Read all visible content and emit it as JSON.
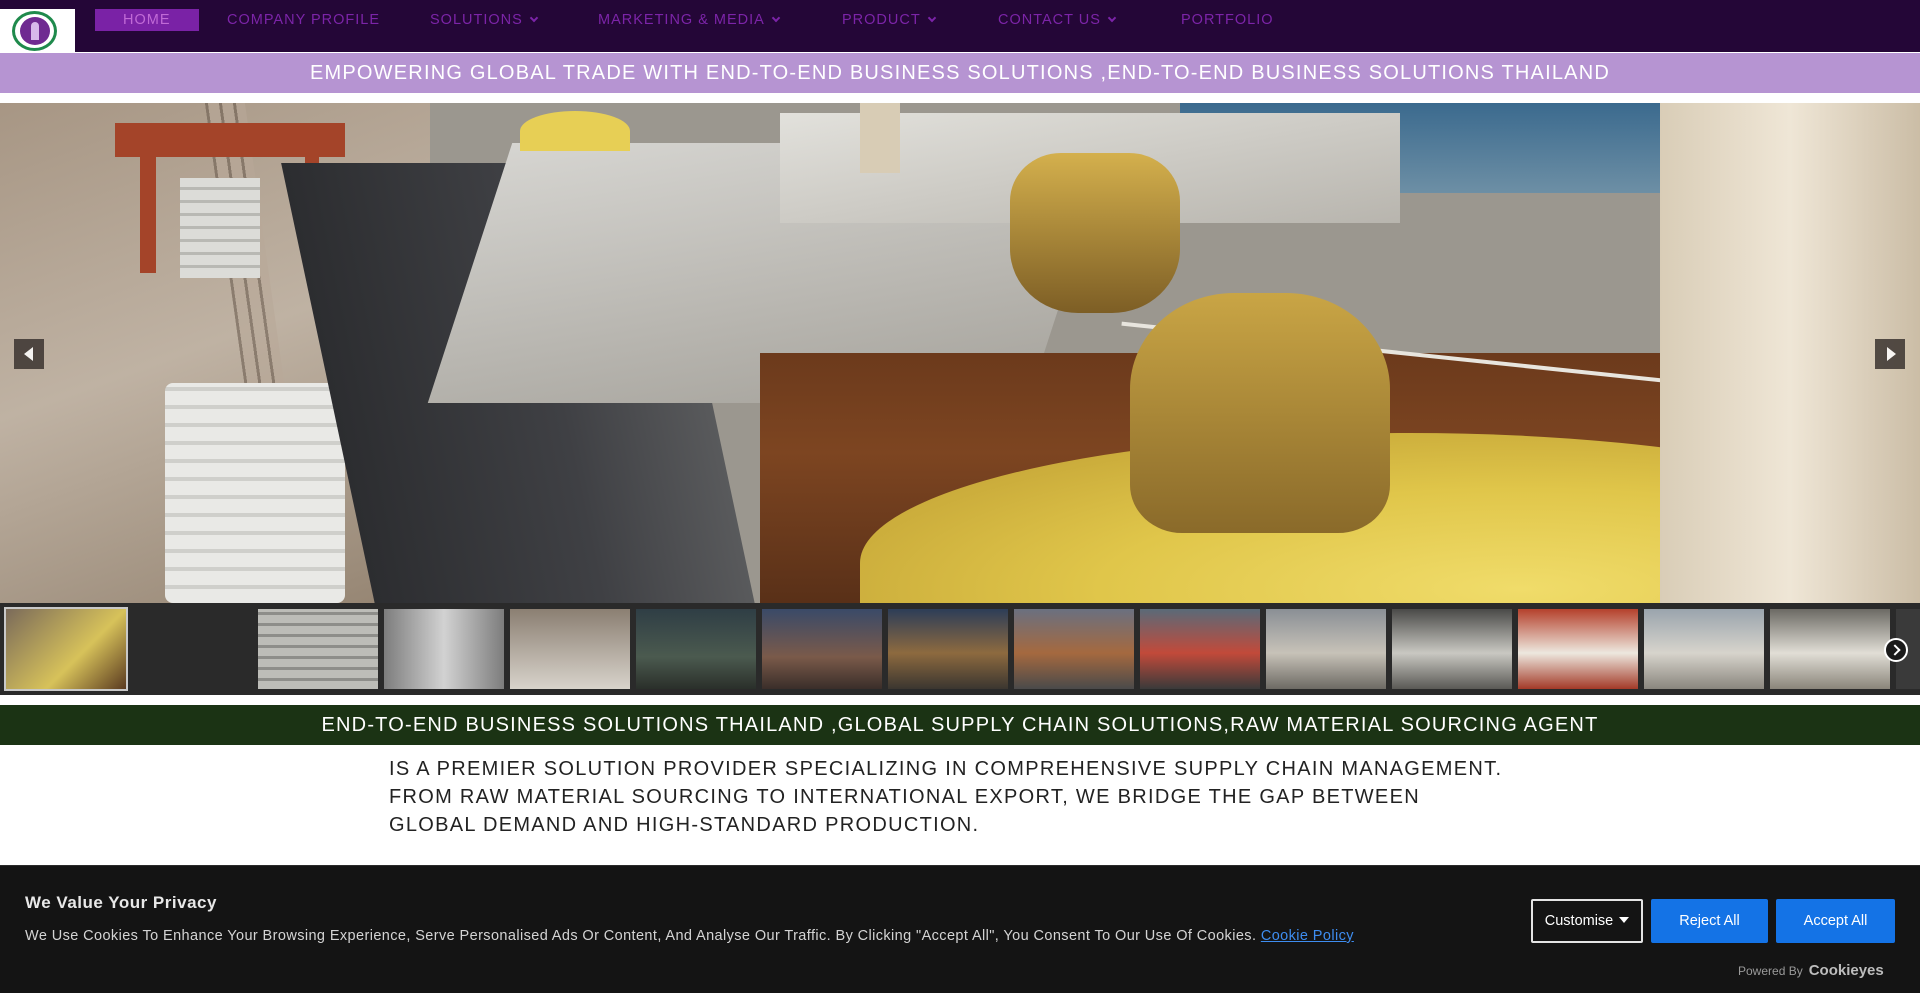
{
  "nav": {
    "items": [
      {
        "label": "HOME",
        "active": true
      },
      {
        "label": "COMPANY PROFILE"
      },
      {
        "label": "SOLUTIONS",
        "dropdown": true
      },
      {
        "label": "MARKETING & MEDIA",
        "dropdown": true
      },
      {
        "label": "PRODUCT",
        "dropdown": true
      },
      {
        "label": "CONTACT US",
        "dropdown": true
      },
      {
        "label": "PORTFOLIO"
      }
    ]
  },
  "banner": {
    "text": "EMPOWERING GLOBAL TRADE WITH END-TO-END BUSINESS SOLUTIONS ,END-TO-END BUSINESS SOLUTIONS THAILAND"
  },
  "thumbnails": {
    "count": 16,
    "selected_index": 0
  },
  "green_banner": {
    "text": "END-TO-END BUSINESS SOLUTIONS THAILAND ,GLOBAL SUPPLY CHAIN SOLUTIONS,RAW MATERIAL SOURCING AGENT"
  },
  "intro": {
    "text": "IS A PREMIER SOLUTION PROVIDER SPECIALIZING IN COMPREHENSIVE SUPPLY CHAIN MANAGEMENT. FROM RAW MATERIAL SOURCING TO INTERNATIONAL EXPORT, WE BRIDGE THE GAP BETWEEN GLOBAL DEMAND AND HIGH-STANDARD PRODUCTION."
  },
  "cookie": {
    "title": "We Value Your Privacy",
    "text": "We Use Cookies To Enhance Your Browsing Experience, Serve Personalised Ads Or Content, And Analyse Our Traffic. By Clicking \"Accept All\", You Consent To Our Use Of Cookies.",
    "link": "Cookie Policy",
    "customise_label": "Customise",
    "reject_label": "Reject All",
    "accept_label": "Accept All",
    "powered_by": "Powered By",
    "brand": "Cookieyes"
  },
  "colors": {
    "nav_bg": "#240637",
    "nav_text": "#7c24a8",
    "banner_bg": "#b694d2",
    "green_banner_bg": "#1b3314",
    "cookie_bg": "#141414",
    "button_blue": "#1473e6"
  },
  "icons": [
    "logo-icon",
    "chevron-down-icon",
    "slider-prev-icon",
    "slider-next-icon",
    "thumb-next-icon",
    "caret-down-icon"
  ]
}
